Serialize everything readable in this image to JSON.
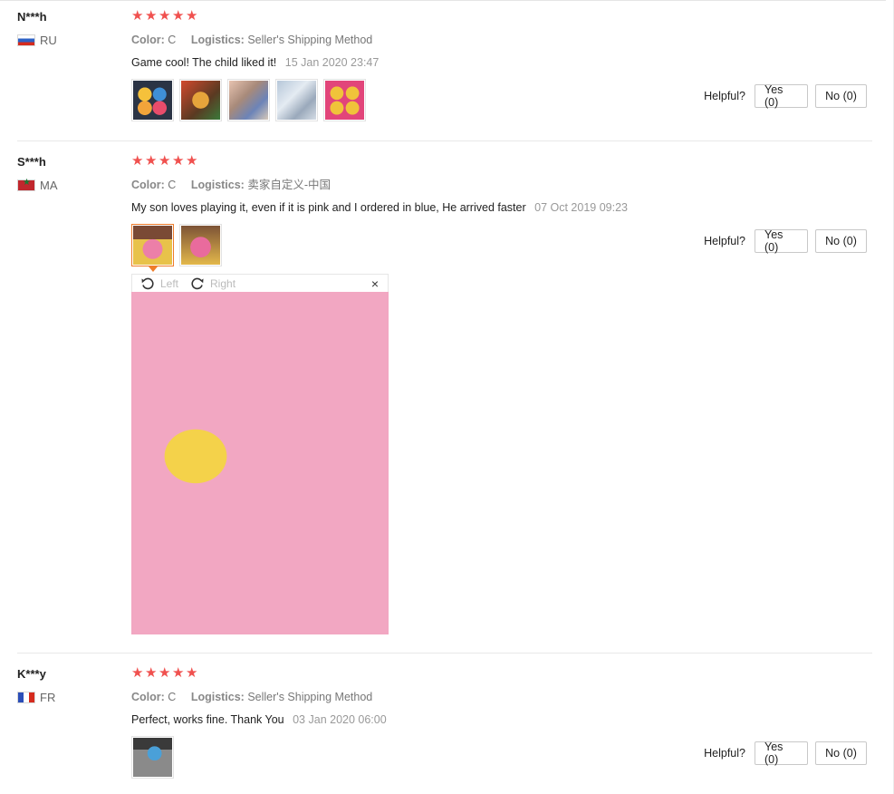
{
  "helpful_label": "Helpful?",
  "reviews": [
    {
      "user": "N***h",
      "country": "RU",
      "stars": 5,
      "props": [
        {
          "label": "Color:",
          "value": "C"
        },
        {
          "label": "Logistics:",
          "value": "Seller's Shipping Method"
        }
      ],
      "text": "Game cool! The child liked it!",
      "date": "15 Jan 2020 23:47",
      "yes": "Yes (0)",
      "no": "No (0)",
      "photo_count": 5
    },
    {
      "user": "S***h",
      "country": "MA",
      "stars": 5,
      "props": [
        {
          "label": "Color:",
          "value": "C"
        },
        {
          "label": "Logistics:",
          "value": "卖家自定义-中国"
        }
      ],
      "text": "My son loves playing it, even if it is pink and I ordered in blue, He arrived faster",
      "date": "07 Oct 2019 09:23",
      "yes": "Yes (0)",
      "no": "No (0)",
      "photo_count": 2
    },
    {
      "user": "K***y",
      "country": "FR",
      "stars": 5,
      "props": [
        {
          "label": "Color:",
          "value": "C"
        },
        {
          "label": "Logistics:",
          "value": "Seller's Shipping Method"
        }
      ],
      "text": "Perfect, works fine. Thank You",
      "date": "03 Jan 2020 06:00",
      "yes": "Yes (0)",
      "no": "No (0)",
      "photo_count": 1
    }
  ],
  "viewer": {
    "rotate_left": "Left",
    "rotate_right": "Right",
    "close": "×"
  },
  "colors": {
    "star": "#f0514f",
    "active_thumb_border": "#ef7d2b"
  }
}
